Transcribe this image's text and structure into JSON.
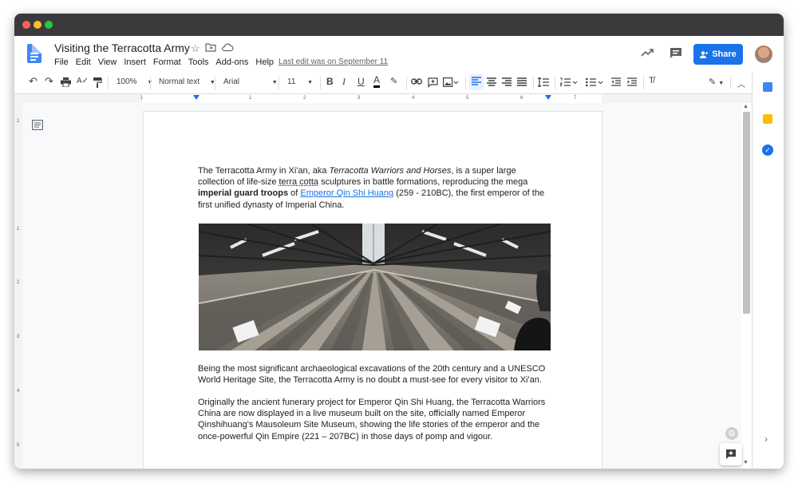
{
  "document": {
    "title": "Visiting the Terracotta Army",
    "last_edit": "Last edit was on September 11"
  },
  "menu": [
    "File",
    "Edit",
    "View",
    "Insert",
    "Format",
    "Tools",
    "Add-ons",
    "Help"
  ],
  "share": {
    "label": "Share"
  },
  "toolbar": {
    "zoom": "100%",
    "style": "Normal text",
    "font": "Arial",
    "size": "11"
  },
  "ruler": {
    "h_marks": [
      "1",
      "1",
      "2",
      "3",
      "4",
      "5",
      "6",
      "7"
    ],
    "v_marks": [
      "1",
      "1",
      "2",
      "3",
      "4",
      "5"
    ]
  },
  "body": {
    "p1": {
      "t1": "The Terracotta Army in Xi'an, aka ",
      "t2": "Terracotta Warriors and Horses",
      "t3": ", is a super large collection of life-size ",
      "t4": "terra cotta",
      "t5": " sculptures in battle formations, reproducing the mega ",
      "t6": "imperial guard troops",
      "t7": " of ",
      "link": "Emperor Qin Shi Huang",
      "t8": " (259 - 210BC), the first emperor of the first unified dynasty of Imperial China."
    },
    "p2": "Being the most significant archaeological excavations of the 20th century and a UNESCO World Heritage Site, the Terracotta Army is no doubt a must-see for every visitor to Xi'an.",
    "p3": "Originally the ancient funerary project for Emperor Qin Shi Huang, the Terracotta Warriors China are now displayed in a live museum built on the site, officially named Emperor Qinshihuang's Mausoleum Site Museum, showing the life stories of the emperor and the once-powerful Qin Empire (221 – 207BC) in those days of pomp and vigour."
  },
  "colors": {
    "accent": "#1a73e8",
    "doc_icon": "#4285f4"
  }
}
